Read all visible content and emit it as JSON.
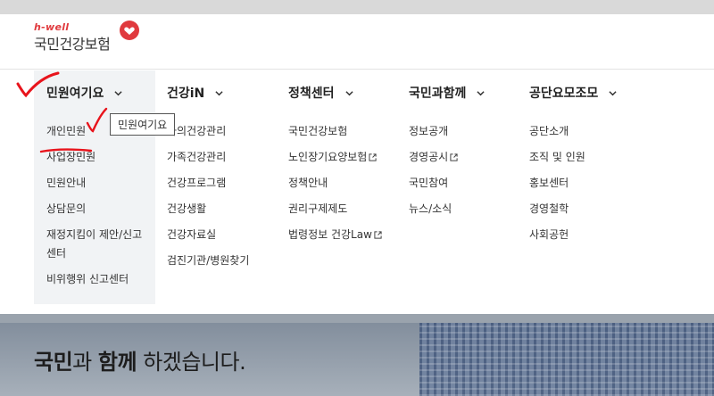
{
  "logo": {
    "brand_small": "h-well",
    "brand_name": "국민건강보험"
  },
  "nav": [
    {
      "label": "민원여기요"
    },
    {
      "label": "건강iN"
    },
    {
      "label": "정책센터"
    },
    {
      "label": "국민과함께"
    },
    {
      "label": "공단요모조모"
    }
  ],
  "tooltip": "민원여기요",
  "menus": {
    "col1": [
      "개인민원",
      "사업장민원",
      "민원안내",
      "상담문의",
      "재정지킴이 제안/신고센터",
      "비위행위 신고센터"
    ],
    "col2": [
      "나의건강관리",
      "가족건강관리",
      "건강프로그램",
      "건강생활",
      "건강자료실",
      "검진기관/병원찾기"
    ],
    "col3": [
      "국민건강보험",
      "노인장기요양보험",
      "정책안내",
      "권리구제제도",
      "법령정보 건강Law"
    ],
    "col4": [
      "정보공개",
      "경영공시",
      "국민참여",
      "뉴스/소식"
    ],
    "col5": [
      "공단소개",
      "조직 및 인원",
      "홍보센터",
      "경영철학",
      "사회공헌"
    ]
  },
  "banner": {
    "slogan_strong1": "국민",
    "slogan_mid": "과 ",
    "slogan_strong2": "함께",
    "slogan_end": " 하겠습니다."
  },
  "colors": {
    "brand_red": "#e03a3e",
    "annotation_red": "#e8141c",
    "menu_bg": "#f1f3f5"
  }
}
